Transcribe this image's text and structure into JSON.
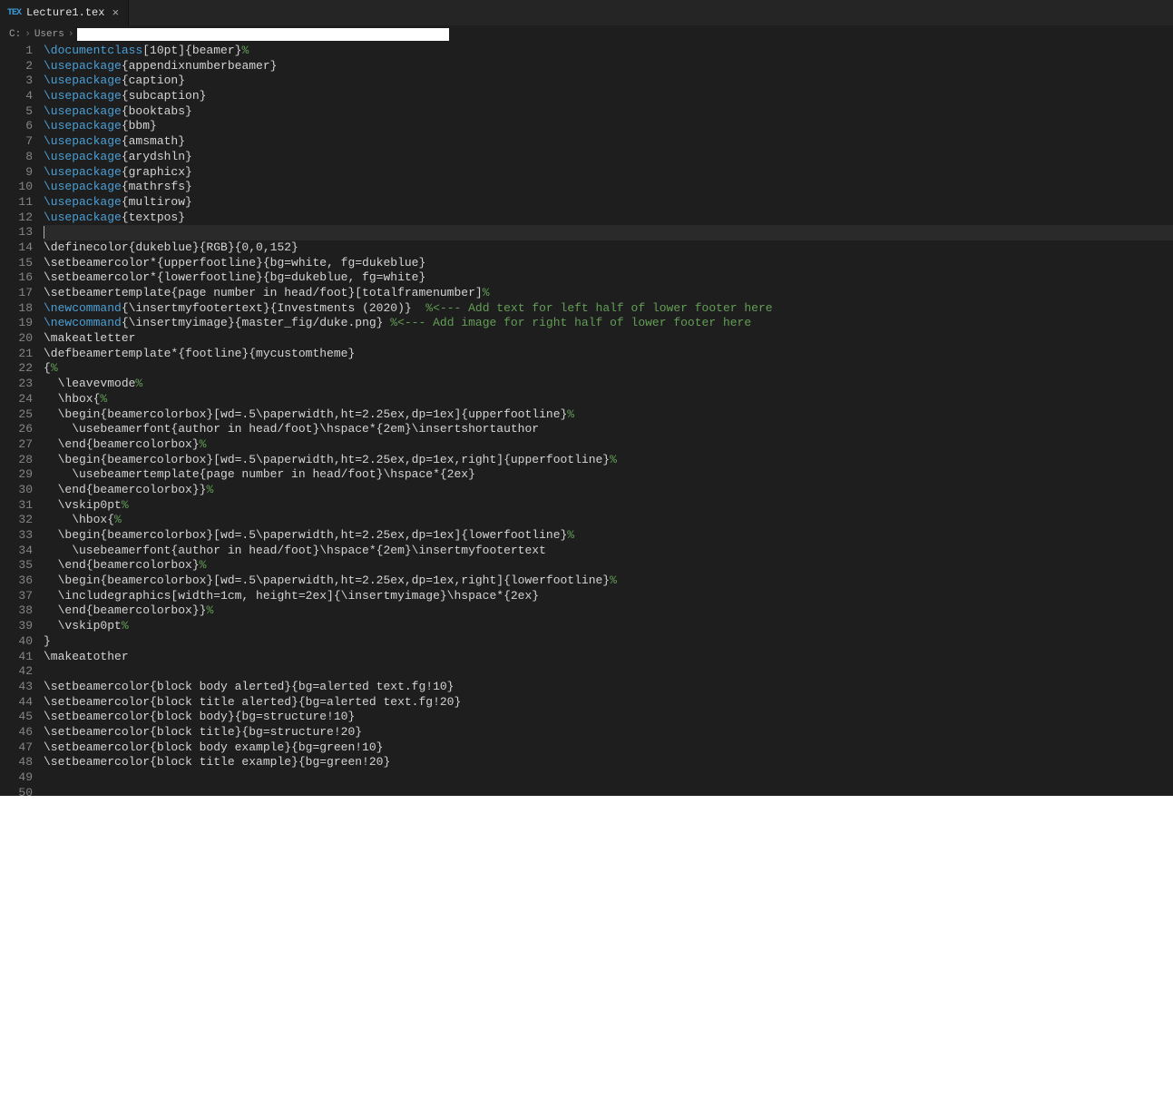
{
  "tab": {
    "icon_label": "TEX",
    "title": "Lecture1.tex"
  },
  "breadcrumb": {
    "seg1": "C:",
    "seg2": "Users"
  },
  "code": [
    {
      "n": 1,
      "tokens": [
        [
          "cmd",
          "\\documentclass"
        ],
        [
          "text",
          "[10pt]{beamer}"
        ],
        [
          "pct",
          "%"
        ]
      ]
    },
    {
      "n": 2,
      "tokens": [
        [
          "cmd",
          "\\usepackage"
        ],
        [
          "text",
          "{appendixnumberbeamer}"
        ]
      ]
    },
    {
      "n": 3,
      "tokens": [
        [
          "cmd",
          "\\usepackage"
        ],
        [
          "text",
          "{caption}"
        ]
      ]
    },
    {
      "n": 4,
      "tokens": [
        [
          "cmd",
          "\\usepackage"
        ],
        [
          "text",
          "{subcaption}"
        ]
      ]
    },
    {
      "n": 5,
      "tokens": [
        [
          "cmd",
          "\\usepackage"
        ],
        [
          "text",
          "{booktabs}"
        ]
      ]
    },
    {
      "n": 6,
      "tokens": [
        [
          "cmd",
          "\\usepackage"
        ],
        [
          "text",
          "{bbm}"
        ]
      ]
    },
    {
      "n": 7,
      "tokens": [
        [
          "cmd",
          "\\usepackage"
        ],
        [
          "text",
          "{amsmath}"
        ]
      ]
    },
    {
      "n": 8,
      "tokens": [
        [
          "cmd",
          "\\usepackage"
        ],
        [
          "text",
          "{arydshln}"
        ]
      ]
    },
    {
      "n": 9,
      "tokens": [
        [
          "cmd",
          "\\usepackage"
        ],
        [
          "text",
          "{graphicx}"
        ]
      ]
    },
    {
      "n": 10,
      "tokens": [
        [
          "cmd",
          "\\usepackage"
        ],
        [
          "text",
          "{mathrsfs}"
        ]
      ]
    },
    {
      "n": 11,
      "tokens": [
        [
          "cmd",
          "\\usepackage"
        ],
        [
          "text",
          "{multirow}"
        ]
      ]
    },
    {
      "n": 12,
      "tokens": [
        [
          "cmd",
          "\\usepackage"
        ],
        [
          "text",
          "{textpos}"
        ]
      ]
    },
    {
      "n": 13,
      "current": true,
      "tokens": [
        [
          "cursor",
          ""
        ]
      ]
    },
    {
      "n": 14,
      "tokens": [
        [
          "text",
          "\\definecolor{dukeblue}{RGB}{0,0,152}"
        ]
      ]
    },
    {
      "n": 15,
      "tokens": [
        [
          "text",
          "\\setbeamercolor*{upperfootline}{bg=white, fg=dukeblue}"
        ]
      ]
    },
    {
      "n": 16,
      "tokens": [
        [
          "text",
          "\\setbeamercolor*{lowerfootline}{bg=dukeblue, fg=white}"
        ]
      ]
    },
    {
      "n": 17,
      "tokens": [
        [
          "text",
          "\\setbeamertemplate{page number in head/foot}[totalframenumber]"
        ],
        [
          "pct",
          "%"
        ]
      ]
    },
    {
      "n": 18,
      "tokens": [
        [
          "cmd",
          "\\newcommand"
        ],
        [
          "text",
          "{\\insertmyfootertext}{Investments (2020)}  "
        ],
        [
          "comment",
          "%<--- Add text for left half of lower footer here"
        ]
      ]
    },
    {
      "n": 19,
      "tokens": [
        [
          "cmd",
          "\\newcommand"
        ],
        [
          "text",
          "{\\insertmyimage}{master_fig/duke.png} "
        ],
        [
          "comment",
          "%<--- Add image for right half of lower footer here"
        ]
      ]
    },
    {
      "n": 20,
      "tokens": [
        [
          "text",
          "\\makeatletter"
        ]
      ]
    },
    {
      "n": 21,
      "tokens": [
        [
          "text",
          "\\defbeamertemplate*{footline}{mycustomtheme}"
        ]
      ]
    },
    {
      "n": 22,
      "tokens": [
        [
          "text",
          "{"
        ],
        [
          "pct",
          "%"
        ]
      ]
    },
    {
      "n": 23,
      "tokens": [
        [
          "text",
          "  \\leavevmode"
        ],
        [
          "pct",
          "%"
        ]
      ]
    },
    {
      "n": 24,
      "tokens": [
        [
          "text",
          "  \\hbox{"
        ],
        [
          "pct",
          "%"
        ]
      ]
    },
    {
      "n": 25,
      "tokens": [
        [
          "text",
          "  \\begin{beamercolorbox}[wd=.5\\paperwidth,ht=2.25ex,dp=1ex]{upperfootline}"
        ],
        [
          "pct",
          "%"
        ]
      ]
    },
    {
      "n": 26,
      "tokens": [
        [
          "text",
          "    \\usebeamerfont{author in head/foot}\\hspace*{2em}\\insertshortauthor"
        ]
      ]
    },
    {
      "n": 27,
      "tokens": [
        [
          "text",
          "  \\end{beamercolorbox}"
        ],
        [
          "pct",
          "%"
        ]
      ]
    },
    {
      "n": 28,
      "tokens": [
        [
          "text",
          "  \\begin{beamercolorbox}[wd=.5\\paperwidth,ht=2.25ex,dp=1ex,right]{upperfootline}"
        ],
        [
          "pct",
          "%"
        ]
      ]
    },
    {
      "n": 29,
      "tokens": [
        [
          "text",
          "    \\usebeamertemplate{page number in head/foot}\\hspace*{2ex}"
        ]
      ]
    },
    {
      "n": 30,
      "tokens": [
        [
          "text",
          "  \\end{beamercolorbox}}"
        ],
        [
          "pct",
          "%"
        ]
      ]
    },
    {
      "n": 31,
      "tokens": [
        [
          "text",
          "  \\vskip0pt"
        ],
        [
          "pct",
          "%"
        ]
      ]
    },
    {
      "n": 32,
      "tokens": [
        [
          "text",
          "    \\hbox{"
        ],
        [
          "pct",
          "%"
        ]
      ]
    },
    {
      "n": 33,
      "tokens": [
        [
          "text",
          "  \\begin{beamercolorbox}[wd=.5\\paperwidth,ht=2.25ex,dp=1ex]{lowerfootline}"
        ],
        [
          "pct",
          "%"
        ]
      ]
    },
    {
      "n": 34,
      "tokens": [
        [
          "text",
          "    \\usebeamerfont{author in head/foot}\\hspace*{2em}\\insertmyfootertext"
        ]
      ]
    },
    {
      "n": 35,
      "tokens": [
        [
          "text",
          "  \\end{beamercolorbox}"
        ],
        [
          "pct",
          "%"
        ]
      ]
    },
    {
      "n": 36,
      "tokens": [
        [
          "text",
          "  \\begin{beamercolorbox}[wd=.5\\paperwidth,ht=2.25ex,dp=1ex,right]{lowerfootline}"
        ],
        [
          "pct",
          "%"
        ]
      ]
    },
    {
      "n": 37,
      "tokens": [
        [
          "text",
          "  \\includegraphics[width=1cm, height=2ex]{\\insertmyimage}\\hspace*{2ex}"
        ]
      ]
    },
    {
      "n": 38,
      "tokens": [
        [
          "text",
          "  \\end{beamercolorbox}}"
        ],
        [
          "pct",
          "%"
        ]
      ]
    },
    {
      "n": 39,
      "tokens": [
        [
          "text",
          "  \\vskip0pt"
        ],
        [
          "pct",
          "%"
        ]
      ]
    },
    {
      "n": 40,
      "tokens": [
        [
          "text",
          "}  "
        ]
      ]
    },
    {
      "n": 41,
      "tokens": [
        [
          "text",
          "\\makeatother"
        ]
      ]
    },
    {
      "n": 42,
      "tokens": []
    },
    {
      "n": 43,
      "tokens": [
        [
          "text",
          "\\setbeamercolor{block body alerted}{bg=alerted text.fg!10}"
        ]
      ]
    },
    {
      "n": 44,
      "tokens": [
        [
          "text",
          "\\setbeamercolor{block title alerted}{bg=alerted text.fg!20}"
        ]
      ]
    },
    {
      "n": 45,
      "tokens": [
        [
          "text",
          "\\setbeamercolor{block body}{bg=structure!10}"
        ]
      ]
    },
    {
      "n": 46,
      "tokens": [
        [
          "text",
          "\\setbeamercolor{block title}{bg=structure!20}"
        ]
      ]
    },
    {
      "n": 47,
      "tokens": [
        [
          "text",
          "\\setbeamercolor{block body example}{bg=green!10}"
        ]
      ]
    },
    {
      "n": 48,
      "tokens": [
        [
          "text",
          "\\setbeamercolor{block title example}{bg=green!20}"
        ]
      ]
    },
    {
      "n": 49,
      "tokens": []
    },
    {
      "n": 50,
      "tokens": []
    }
  ]
}
